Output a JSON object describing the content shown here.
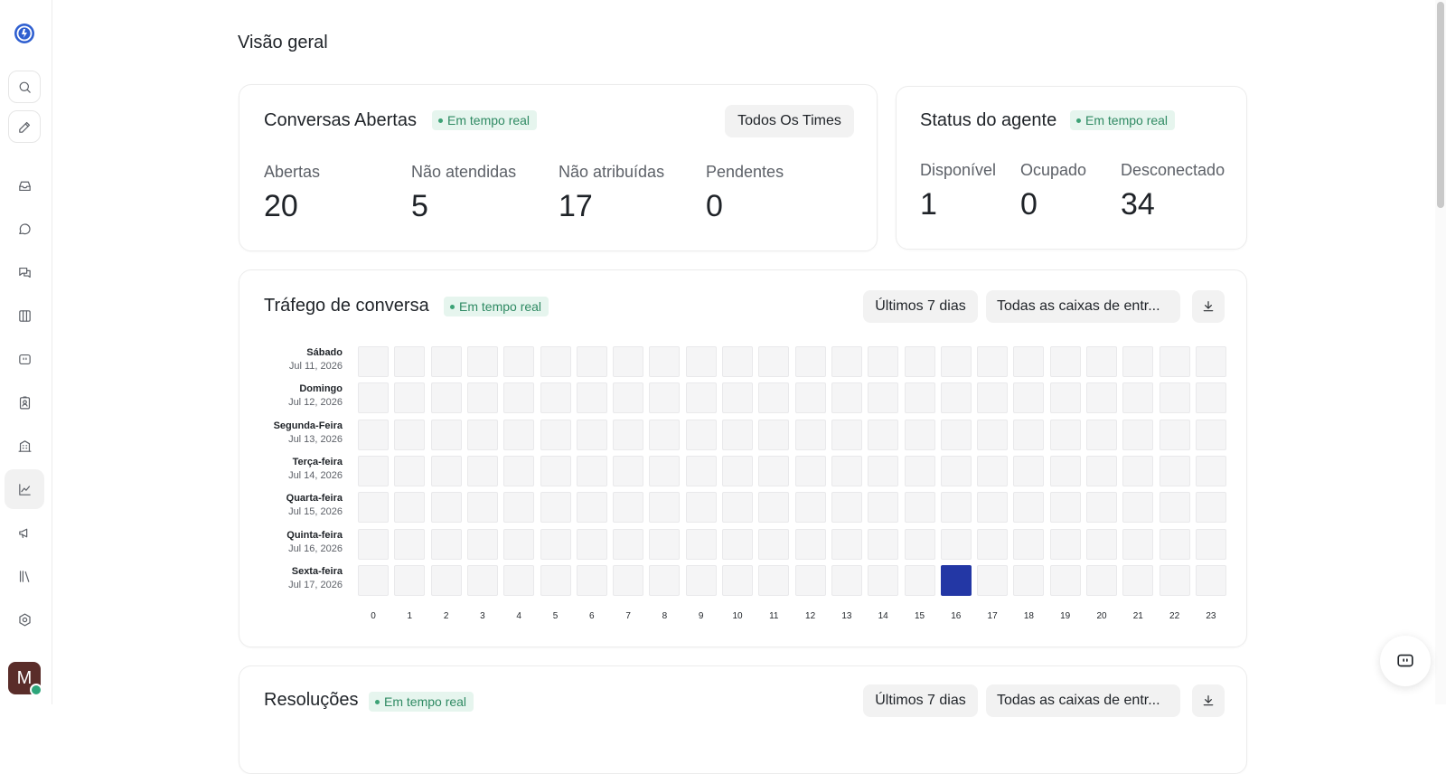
{
  "user": {
    "avatar_letter": "M"
  },
  "sidebar": {
    "items": [
      {
        "name": "logo-icon"
      },
      {
        "name": "search-icon"
      },
      {
        "name": "compose-icon"
      },
      {
        "name": "inbox-icon"
      },
      {
        "name": "conversations-icon"
      },
      {
        "name": "captain-icon"
      },
      {
        "name": "kanban-icon"
      },
      {
        "name": "chatbot-icon"
      },
      {
        "name": "contacts-icon"
      },
      {
        "name": "companies-icon"
      },
      {
        "name": "reports-icon",
        "active": true
      },
      {
        "name": "campaigns-icon"
      },
      {
        "name": "library-icon"
      },
      {
        "name": "settings-icon"
      }
    ]
  },
  "page": {
    "title": "Visão geral"
  },
  "open_conversations": {
    "title": "Conversas Abertas",
    "badge": "Em tempo real",
    "filter_label": "Todos Os Times",
    "metrics": [
      {
        "label": "Abertas",
        "value": "20"
      },
      {
        "label": "Não atendidas",
        "value": "5"
      },
      {
        "label": "Não atribuídas",
        "value": "17"
      },
      {
        "label": "Pendentes",
        "value": "0"
      }
    ]
  },
  "agent_status": {
    "title": "Status do agente",
    "badge": "Em tempo real",
    "metrics": [
      {
        "label": "Disponível",
        "value": "1"
      },
      {
        "label": "Ocupado",
        "value": "0"
      },
      {
        "label": "Desconectado",
        "value": "34"
      }
    ]
  },
  "traffic": {
    "title": "Tráfego de conversa",
    "badge": "Em tempo real",
    "range_label": "Últimos 7 dias",
    "inbox_label": "Todas as caixas de entr...",
    "download_icon": "download-icon",
    "colors": {
      "empty": "#f5f5f6",
      "hot": "#2337a5"
    },
    "chart_data": {
      "type": "heatmap",
      "rows": [
        {
          "day": "Sábado",
          "date": "Jul 11, 2026"
        },
        {
          "day": "Domingo",
          "date": "Jul 12, 2026"
        },
        {
          "day": "Segunda-Feira",
          "date": "Jul 13, 2026"
        },
        {
          "day": "Terça-feira",
          "date": "Jul 14, 2026"
        },
        {
          "day": "Quarta-feira",
          "date": "Jul 15, 2026"
        },
        {
          "day": "Quinta-feira",
          "date": "Jul 16, 2026"
        },
        {
          "day": "Sexta-feira",
          "date": "Jul 17, 2026"
        }
      ],
      "hours": [
        "0",
        "1",
        "2",
        "3",
        "4",
        "5",
        "6",
        "7",
        "8",
        "9",
        "10",
        "11",
        "12",
        "13",
        "14",
        "15",
        "16",
        "17",
        "18",
        "19",
        "20",
        "21",
        "22",
        "23"
      ],
      "values": [
        [
          0,
          0,
          0,
          0,
          0,
          0,
          0,
          0,
          0,
          0,
          0,
          0,
          0,
          0,
          0,
          0,
          0,
          0,
          0,
          0,
          0,
          0,
          0,
          0
        ],
        [
          0,
          0,
          0,
          0,
          0,
          0,
          0,
          0,
          0,
          0,
          0,
          0,
          0,
          0,
          0,
          0,
          0,
          0,
          0,
          0,
          0,
          0,
          0,
          0
        ],
        [
          0,
          0,
          0,
          0,
          0,
          0,
          0,
          0,
          0,
          0,
          0,
          0,
          0,
          0,
          0,
          0,
          0,
          0,
          0,
          0,
          0,
          0,
          0,
          0
        ],
        [
          0,
          0,
          0,
          0,
          0,
          0,
          0,
          0,
          0,
          0,
          0,
          0,
          0,
          0,
          0,
          0,
          0,
          0,
          0,
          0,
          0,
          0,
          0,
          0
        ],
        [
          0,
          0,
          0,
          0,
          0,
          0,
          0,
          0,
          0,
          0,
          0,
          0,
          0,
          0,
          0,
          0,
          0,
          0,
          0,
          0,
          0,
          0,
          0,
          0
        ],
        [
          0,
          0,
          0,
          0,
          0,
          0,
          0,
          0,
          0,
          0,
          0,
          0,
          0,
          0,
          0,
          0,
          0,
          0,
          0,
          0,
          0,
          0,
          0,
          0
        ],
        [
          0,
          0,
          0,
          0,
          0,
          0,
          0,
          0,
          0,
          0,
          0,
          0,
          0,
          0,
          0,
          0,
          1,
          0,
          0,
          0,
          0,
          0,
          0,
          0
        ]
      ]
    }
  },
  "resolutions": {
    "title": "Resoluções",
    "badge": "Em tempo real",
    "range_label": "Últimos 7 dias",
    "inbox_label": "Todas as caixas de entr...",
    "download_icon": "download-icon"
  },
  "chat_widget": {
    "icon": "chat-widget-icon"
  }
}
